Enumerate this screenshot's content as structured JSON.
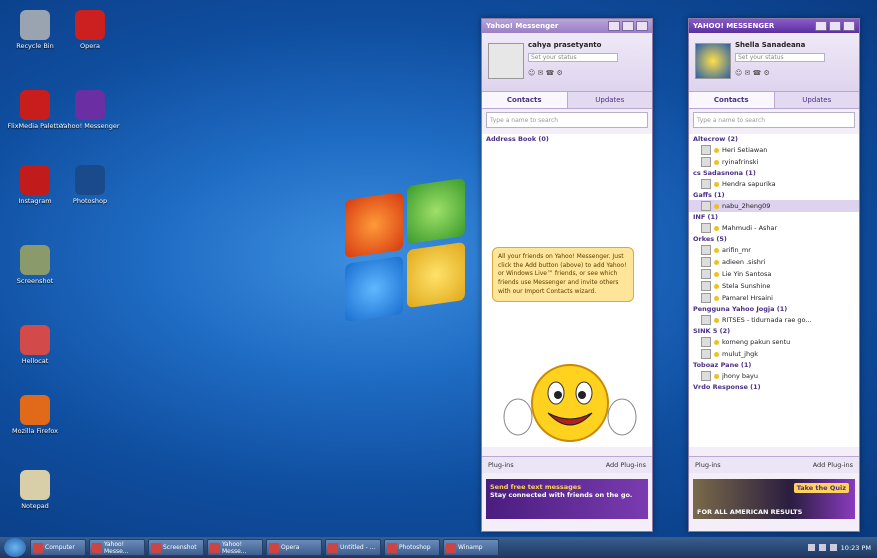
{
  "desktop_icons": [
    {
      "label": "Recycle Bin",
      "icon": "recycle-bin-icon",
      "color": "#9aa4b0"
    },
    {
      "label": "Opera",
      "icon": "opera-icon",
      "color": "#cc1f1f"
    },
    {
      "label": "FlixMedia Palette",
      "icon": "flixmedia-icon",
      "color": "#c81d1d"
    },
    {
      "label": "Yahoo! Messenger",
      "icon": "yahoo-messenger-icon",
      "color": "#6b2fa3"
    },
    {
      "label": "Instagram",
      "icon": "instagram-icon",
      "color": "#c21b1b"
    },
    {
      "label": "Photoshop",
      "icon": "photoshop-icon",
      "color": "#1a4a8a"
    },
    {
      "label": "Screenshot",
      "icon": "screenshot-icon",
      "color": "#8a9a6a"
    },
    {
      "label": "Hellocat",
      "icon": "hellocat-icon",
      "color": "#d24a4a"
    },
    {
      "label": "Mozilla Firefox",
      "icon": "firefox-icon",
      "color": "#e06a1a"
    },
    {
      "label": "Notepad",
      "icon": "notepad-icon",
      "color": "#d8cfa8"
    }
  ],
  "window1": {
    "title": "Yahoo! Messenger",
    "profile_name": "cahya prasetyanto",
    "status_placeholder": "Set your status",
    "tabs": [
      "Contacts",
      "Updates"
    ],
    "search_placeholder": "Type a name to search",
    "group": "Address Book (0)",
    "bubble_text": "All your friends on Yahoo! Messenger. Just click the Add button (above) to add Yahoo! or Windows Live™ friends, or see which friends use Messenger and invite others with our Import Contacts wizard.",
    "footer_left": "Plug-ins",
    "footer_right": "Add Plug-ins",
    "ad_title": "Send free text messages",
    "ad_body": "Stay connected with friends on the go."
  },
  "window2": {
    "title": "YAHOO! MESSENGER",
    "profile_name": "Shella Sanadeana",
    "status_placeholder": "Set your status",
    "tabs": [
      "Contacts",
      "Updates"
    ],
    "search_placeholder": "Type a name to search",
    "groups": [
      {
        "name": "Altecrow (2)",
        "contacts": [
          "Heri Setiawan",
          "ryinafrinski"
        ]
      },
      {
        "name": "cs Sadasnona (1)",
        "contacts": [
          "Hendra sapurika"
        ]
      },
      {
        "name": "Gaffs (1)",
        "contacts": [
          "nabu_2heng09"
        ]
      },
      {
        "name": "INF (1)",
        "contacts": [
          "Mahmudi - Ashar"
        ]
      },
      {
        "name": "Orkes (5)",
        "contacts": [
          "arifin_mr",
          "adieen .sishri",
          "Lie Yin Santosa",
          "Stela Sunshine",
          "Pamarel Hrsaini"
        ]
      },
      {
        "name": "Pengguna Yahoo Jogja (1)",
        "contacts": [
          "RITSES - tidurnada rae go..."
        ]
      },
      {
        "name": "SINK 5 (2)",
        "contacts": [
          "komeng pakun sentu",
          "mulut_jhgk"
        ]
      },
      {
        "name": "Toboaz Pane (1)",
        "contacts": [
          "jhony bayu"
        ]
      },
      {
        "name": "Vrdo Response (1)",
        "contacts": []
      }
    ],
    "selected_contact": "nabu_2heng09",
    "footer_left": "Plug-ins",
    "footer_right": "Add Plug-ins",
    "ad_bottom": "FOR ALL AMERICAN RESULTS",
    "ad_button": "Take the Quiz"
  },
  "taskbar": {
    "items": [
      "Computer",
      "Yahoo! Messe...",
      "Screenshot",
      "Yahoo! Messe...",
      "Opera",
      "Untitled - ...",
      "Photoshop",
      "Winamp"
    ],
    "clock": "10:23 PM"
  }
}
